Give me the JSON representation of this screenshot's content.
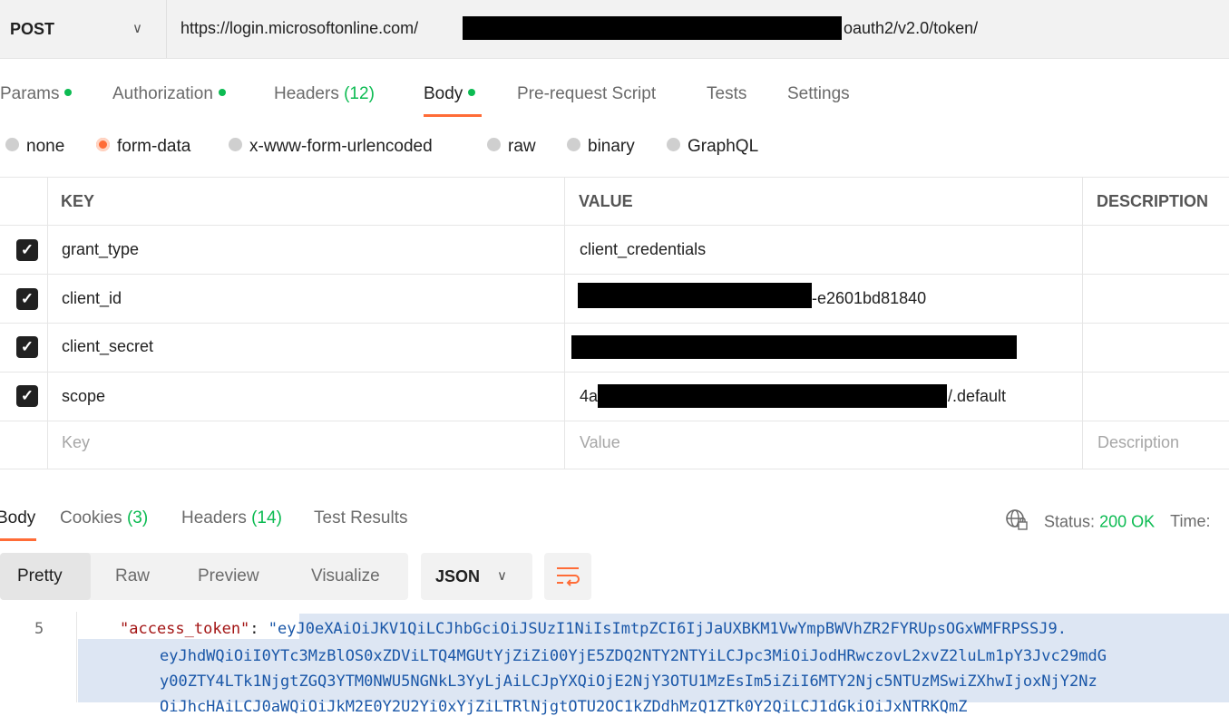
{
  "request": {
    "method": "POST",
    "url_start": "https://login.microsoftonline.com/",
    "url_end": "oauth2/v2.0/token/"
  },
  "request_tabs": [
    {
      "label": "Params",
      "dot": true
    },
    {
      "label": "Authorization",
      "dot": true
    },
    {
      "label": "Headers",
      "count": "(12)"
    },
    {
      "label": "Body",
      "dot": true,
      "active": true
    },
    {
      "label": "Pre-request Script"
    },
    {
      "label": "Tests"
    },
    {
      "label": "Settings"
    }
  ],
  "body_types": [
    "none",
    "form-data",
    "x-www-form-urlencoded",
    "raw",
    "binary",
    "GraphQL"
  ],
  "body_type_selected": "form-data",
  "table": {
    "headers": [
      "KEY",
      "VALUE",
      "DESCRIPTION"
    ],
    "rows": [
      {
        "checked": true,
        "key": "grant_type",
        "value": "client_credentials"
      },
      {
        "checked": true,
        "key": "client_id",
        "value": "-e2601bd81840"
      },
      {
        "checked": true,
        "key": "client_secret",
        "value": ""
      },
      {
        "checked": true,
        "key": "scope",
        "value_start": "4a",
        "value_end": "/.default"
      }
    ],
    "placeholders": {
      "key": "Key",
      "value": "Value",
      "description": "Description"
    }
  },
  "response_tabs": [
    {
      "label": "Body",
      "active": true
    },
    {
      "label": "Cookies",
      "count": "(3)"
    },
    {
      "label": "Headers",
      "count": "(14)"
    },
    {
      "label": "Test Results"
    }
  ],
  "status": {
    "label": "Status:",
    "value": "200 OK",
    "time_label": "Time:"
  },
  "view_modes": [
    "Pretty",
    "Raw",
    "Preview",
    "Visualize"
  ],
  "view_selected": "Pretty",
  "format": "JSON",
  "code": {
    "line_number": "5",
    "key": "\"access_token\"",
    "colon": ": ",
    "lines": [
      "\"eyJ0eXAiOiJKV1QiLCJhbGciOiJSUzI1NiIsImtpZCI6IjJaUXBKM1VwYmpBWVhZR2FYRUpsOGxWMFRPSSJ9.",
      "eyJhdWQiOiI0YTc3MzBlOS0xZDViLTQ4MGUtYjZiZi00YjE5ZDQ2NTY2NTYiLCJpc3MiOiJodHRwczovL2xvZ2luLm1pY3Jvc29mdG",
      "y00ZTY4LTk1NjgtZGQ3YTM0NWU5NGNkL3YyLjAiLCJpYXQiOjE2NjY3OTU1MzEsIm5iZiI6MTY2Njc5NTUzMSwiZXhwIjoxNjY2Nz",
      "OiJhcHAiLCJ0aWQiOiJkM2E0Y2U2Yi0xYjZiLTRlNjgtOTU2OC1kZDdhMzQ1ZTk0Y2QiLCJ1dGkiOiJxNTRKQmZ"
    ]
  },
  "colors": {
    "accent": "#ff6c37",
    "green": "#0cbb52",
    "code_string": "#1a57a8",
    "code_key": "#a31515"
  }
}
